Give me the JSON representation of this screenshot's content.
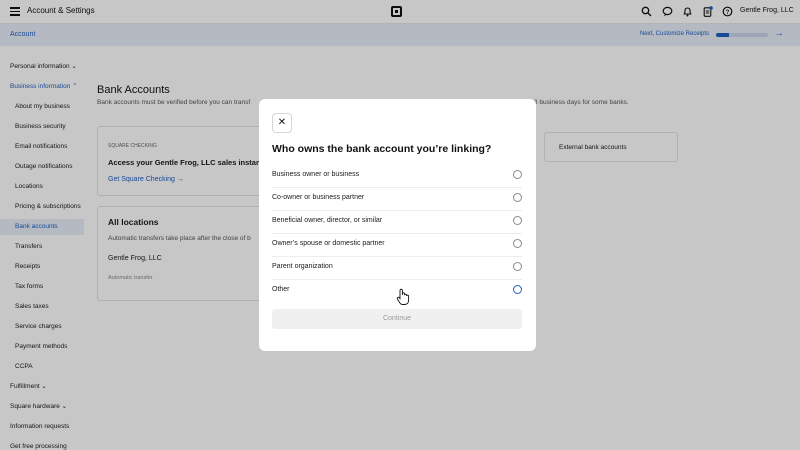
{
  "topbar": {
    "title": "Account & Settings",
    "icons": [
      "hamburger-icon",
      "square-logo-icon",
      "search-icon",
      "messages-icon",
      "bell-icon",
      "clipboard-icon",
      "help-icon"
    ],
    "business_name": "Gentle Frog, LLC"
  },
  "accountbar": {
    "label": "Account",
    "next_label": "Next, Customize Receipts",
    "progress": 0.25
  },
  "sidebar": {
    "items": [
      {
        "label": "Personal information ⌄"
      },
      {
        "label": "Business information ⌃"
      },
      {
        "label": "About my business"
      },
      {
        "label": "Business security"
      },
      {
        "label": "Email notifications"
      },
      {
        "label": "Outage notifications"
      },
      {
        "label": "Locations"
      },
      {
        "label": "Pricing & subscriptions"
      },
      {
        "label": "Bank accounts"
      },
      {
        "label": "Transfers"
      },
      {
        "label": "Receipts"
      },
      {
        "label": "Tax forms"
      },
      {
        "label": "Sales taxes"
      },
      {
        "label": "Service charges"
      },
      {
        "label": "Payment methods"
      },
      {
        "label": "CCPA"
      },
      {
        "label": "Fulfillment ⌄"
      },
      {
        "label": "Square hardware ⌄"
      },
      {
        "label": "Information requests"
      },
      {
        "label": "Get free processing"
      }
    ]
  },
  "main": {
    "title": "Bank Accounts",
    "description_left": "Bank accounts must be verified before you can transf",
    "description_right": "3 business days for some banks.",
    "square_checking": {
      "eyebrow": "SQUARE CHECKING",
      "headline": "Access your Gentle Frog, LLC sales instant",
      "cta": "Get Square Checking →"
    },
    "external": {
      "label": "External bank accounts"
    },
    "all_locations": {
      "title": "All locations",
      "description": "Automatic transfers take place after the close of b",
      "business": "Gentle Frog, LLC",
      "transfer_label": "Automatic transfer"
    }
  },
  "modal": {
    "close_glyph": "✕",
    "title": "Who owns the bank account you’re linking?",
    "options": [
      {
        "label": "Business owner or business"
      },
      {
        "label": "Co-owner or business partner"
      },
      {
        "label": "Beneficial owner, director, or similar"
      },
      {
        "label": "Owner’s spouse or domestic partner"
      },
      {
        "label": "Parent organization"
      },
      {
        "label": "Other"
      }
    ],
    "continue_label": "Continue"
  }
}
